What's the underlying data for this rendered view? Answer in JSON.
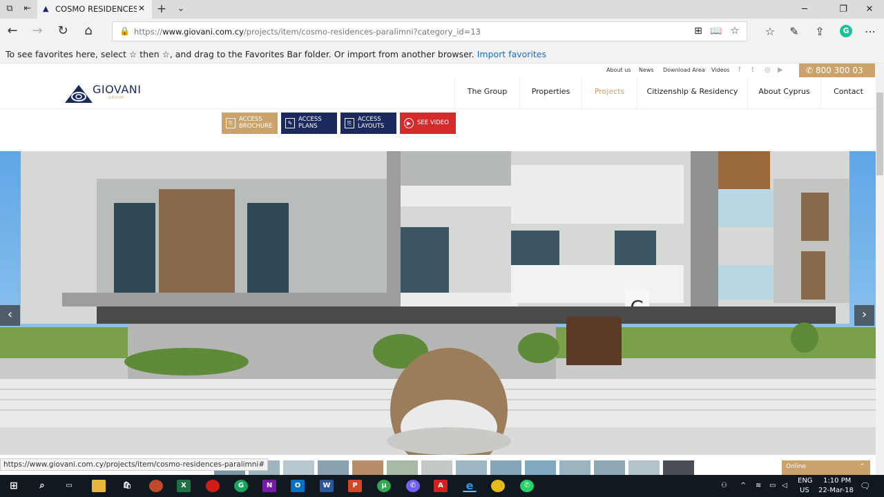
{
  "browser": {
    "tab_title": "COSMO RESIDENCES - I",
    "url_prefix": "https://",
    "url_domain": "www.giovani.com.cy",
    "url_path": "/projects/item/cosmo-residences-paralimni?category_id=13"
  },
  "favorites_bar": {
    "message": "To see favorites here, select ☆ then ☆, and drag to the Favorites Bar folder. Or import from another browser.",
    "import_link": "Import favorites"
  },
  "site": {
    "top_links": [
      "About us",
      "News",
      "Download Area",
      "Videos"
    ],
    "phone": "800 300 03",
    "logo_text": "GIOVANI",
    "logo_sub": "GROUP",
    "menu": [
      "The Group",
      "Properties",
      "Projects",
      "Citizenship & Residency",
      "About Cyprus",
      "Contact"
    ],
    "active_menu": "Projects",
    "buttons": [
      {
        "label": "ACCESS\nBROCHURE",
        "color": "#c9a36b"
      },
      {
        "label": "ACCESS\nPLANS",
        "color": "#1b2a5e"
      },
      {
        "label": "ACCESS\nLAYOUTS",
        "color": "#1b2a5e"
      },
      {
        "label": "SEE VIDEO",
        "color": "#d62b2b"
      }
    ],
    "online_label": "Online"
  },
  "status_url": "https://www.giovani.com.cy/projects/item/cosmo-residences-paralimni#",
  "taskbar": {
    "lang_top": "ENG",
    "lang_bottom": "US",
    "time": "1:10 PM",
    "date": "22-Mar-18"
  },
  "colors": {
    "accent_gold": "#c9a36b",
    "brand_navy": "#1b2a5e",
    "video_red": "#d62b2b"
  }
}
